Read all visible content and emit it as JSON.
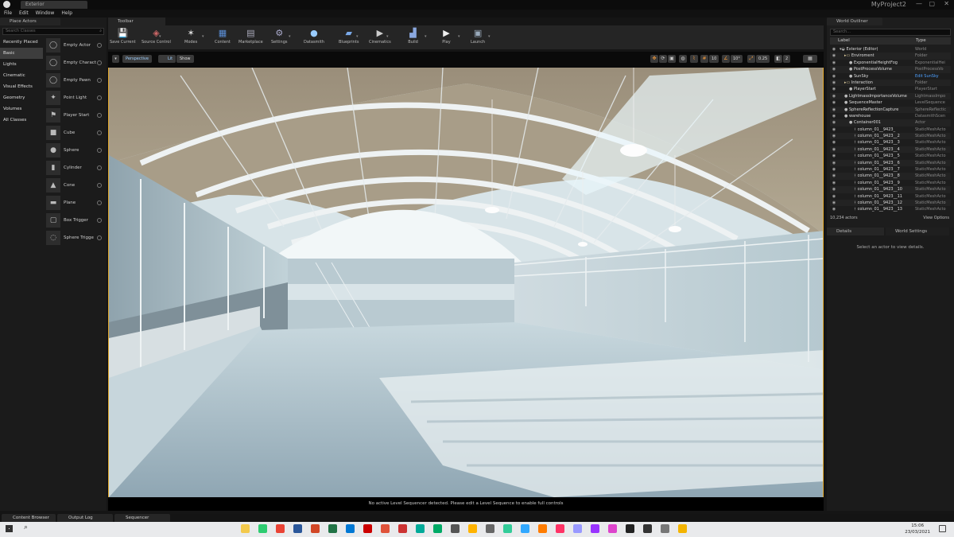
{
  "window": {
    "tab_title": "Exterior",
    "project_title": "MyProject2"
  },
  "menu": [
    "File",
    "Edit",
    "Window",
    "Help"
  ],
  "place_actors": {
    "tab_label": "Place Actors",
    "search_placeholder": "Search Classes",
    "categories": [
      {
        "label": "Recently Placed",
        "selected": false
      },
      {
        "label": "Basic",
        "selected": true
      },
      {
        "label": "Lights",
        "selected": false
      },
      {
        "label": "Cinematic",
        "selected": false
      },
      {
        "label": "Visual Effects",
        "selected": false
      },
      {
        "label": "Geometry",
        "selected": false
      },
      {
        "label": "Volumes",
        "selected": false
      },
      {
        "label": "All Classes",
        "selected": false
      }
    ],
    "actors": [
      "Empty Actor",
      "Empty Charact",
      "Empty Pawn",
      "Point Light",
      "Player Start",
      "Cube",
      "Sphere",
      "Cylinder",
      "Cone",
      "Plane",
      "Box Trigger",
      "Sphere Trigge"
    ]
  },
  "toolbar": {
    "tab_label": "Toolbar",
    "buttons": [
      {
        "label": "Save Current",
        "icon": "save-icon"
      },
      {
        "label": "Source Control",
        "icon": "source-control-icon"
      },
      {
        "label": "Modes",
        "icon": "modes-icon"
      },
      {
        "label": "Content",
        "icon": "content-icon"
      },
      {
        "label": "Marketplace",
        "icon": "marketplace-icon"
      },
      {
        "label": "Settings",
        "icon": "settings-icon"
      },
      {
        "label": "Datasmith",
        "icon": "datasmith-icon"
      },
      {
        "label": "Blueprints",
        "icon": "blueprints-icon"
      },
      {
        "label": "Cinematics",
        "icon": "cinematics-icon"
      },
      {
        "label": "Build",
        "icon": "build-icon"
      },
      {
        "label": "Play",
        "icon": "play-icon"
      },
      {
        "label": "Launch",
        "icon": "launch-icon"
      }
    ]
  },
  "viewport": {
    "perspective_label": "Perspective",
    "lit_label": "Lit",
    "show_label": "Show",
    "grid_snap": "10",
    "rotation_snap": "10°",
    "scale_snap": "0.25",
    "camera_speed": "2",
    "status_message": "No active Level Sequencer detected. Please edit a Level Sequence to enable full controls"
  },
  "world_outliner": {
    "tab_label": "World Outliner",
    "search_placeholder": "Search...",
    "col_label": "Label",
    "col_type": "Type",
    "rows": [
      {
        "label": "Exterior (Editor)",
        "type": "World",
        "depth": 0,
        "kind": "world"
      },
      {
        "label": "Enviroment",
        "type": "Folder",
        "depth": 1,
        "kind": "folder"
      },
      {
        "label": "ExponentialHeightFog",
        "type": "ExponentialHei",
        "depth": 2,
        "kind": "actor"
      },
      {
        "label": "PostProcessVolume",
        "type": "PostProcessVo",
        "depth": 2,
        "kind": "actor"
      },
      {
        "label": "SunSky",
        "type": "Edit SunSky",
        "depth": 2,
        "kind": "actor",
        "link": true
      },
      {
        "label": "Interaction",
        "type": "Folder",
        "depth": 1,
        "kind": "folder"
      },
      {
        "label": "PlayerStart",
        "type": "PlayerStart",
        "depth": 2,
        "kind": "actor"
      },
      {
        "label": "LightmassImportanceVolume",
        "type": "LightmassImpo",
        "depth": 1,
        "kind": "actor"
      },
      {
        "label": "SequenceMaster",
        "type": "LevelSequence",
        "depth": 1,
        "kind": "actor"
      },
      {
        "label": "SphereReflectionCapture",
        "type": "SphereReflectic",
        "depth": 1,
        "kind": "actor"
      },
      {
        "label": "warehouse",
        "type": "DatasmithScen",
        "depth": 1,
        "kind": "actor"
      },
      {
        "label": "Container001",
        "type": "Actor",
        "depth": 2,
        "kind": "actor"
      },
      {
        "label": "column_01__9423_",
        "type": "StaticMeshActo",
        "depth": 3,
        "kind": "mesh"
      },
      {
        "label": "column_01__9423__2",
        "type": "StaticMeshActo",
        "depth": 3,
        "kind": "mesh"
      },
      {
        "label": "column_01__9423__3",
        "type": "StaticMeshActo",
        "depth": 3,
        "kind": "mesh"
      },
      {
        "label": "column_01__9423__4",
        "type": "StaticMeshActo",
        "depth": 3,
        "kind": "mesh"
      },
      {
        "label": "column_01__9423__5",
        "type": "StaticMeshActo",
        "depth": 3,
        "kind": "mesh"
      },
      {
        "label": "column_01__9423__6",
        "type": "StaticMeshActo",
        "depth": 3,
        "kind": "mesh"
      },
      {
        "label": "column_01__9423__7",
        "type": "StaticMeshActo",
        "depth": 3,
        "kind": "mesh"
      },
      {
        "label": "column_01__9423__8",
        "type": "StaticMeshActo",
        "depth": 3,
        "kind": "mesh"
      },
      {
        "label": "column_01__9423__9",
        "type": "StaticMeshActo",
        "depth": 3,
        "kind": "mesh"
      },
      {
        "label": "column_01__9423__10",
        "type": "StaticMeshActo",
        "depth": 3,
        "kind": "mesh"
      },
      {
        "label": "column_01__9423__11",
        "type": "StaticMeshActo",
        "depth": 3,
        "kind": "mesh"
      },
      {
        "label": "column_01__9423__12",
        "type": "StaticMeshActo",
        "depth": 3,
        "kind": "mesh"
      },
      {
        "label": "column_01__9423__13",
        "type": "StaticMeshActo",
        "depth": 3,
        "kind": "mesh"
      }
    ],
    "actor_count": "10,234 actors",
    "view_options": "View Options"
  },
  "details": {
    "tab_details": "Details",
    "tab_world_settings": "World Settings",
    "empty_message": "Select an actor to view details."
  },
  "bottom_tabs": [
    "Content Browser",
    "Output Log",
    "Sequencer"
  ],
  "taskbar": {
    "time": "15:06",
    "date": "23/03/2021"
  },
  "colors": {
    "accent": "#e3a92d",
    "link": "#4ea1ff",
    "background": "#1b1b1b"
  }
}
